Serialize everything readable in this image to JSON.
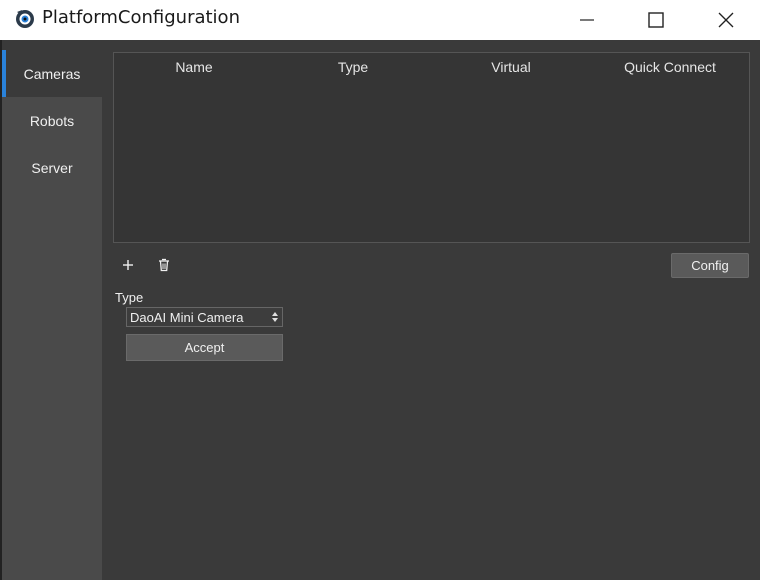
{
  "window": {
    "title": "PlatformConfiguration",
    "icon": "camera-eye-icon"
  },
  "sidebar": {
    "items": [
      {
        "label": "Cameras",
        "active": true
      },
      {
        "label": "Robots",
        "active": false
      },
      {
        "label": "Server",
        "active": false
      }
    ]
  },
  "table": {
    "columns": [
      "Name",
      "Type",
      "Virtual",
      "Quick Connect"
    ],
    "rows": []
  },
  "toolbar": {
    "add_icon": "plus-icon",
    "delete_icon": "trash-icon",
    "config_label": "Config"
  },
  "form": {
    "type_label": "Type",
    "type_selected": "DaoAI Mini Camera",
    "accept_label": "Accept"
  },
  "colors": {
    "accent": "#2a82da",
    "background": "#3a3a3a",
    "sidebar": "#4a4a4a"
  }
}
